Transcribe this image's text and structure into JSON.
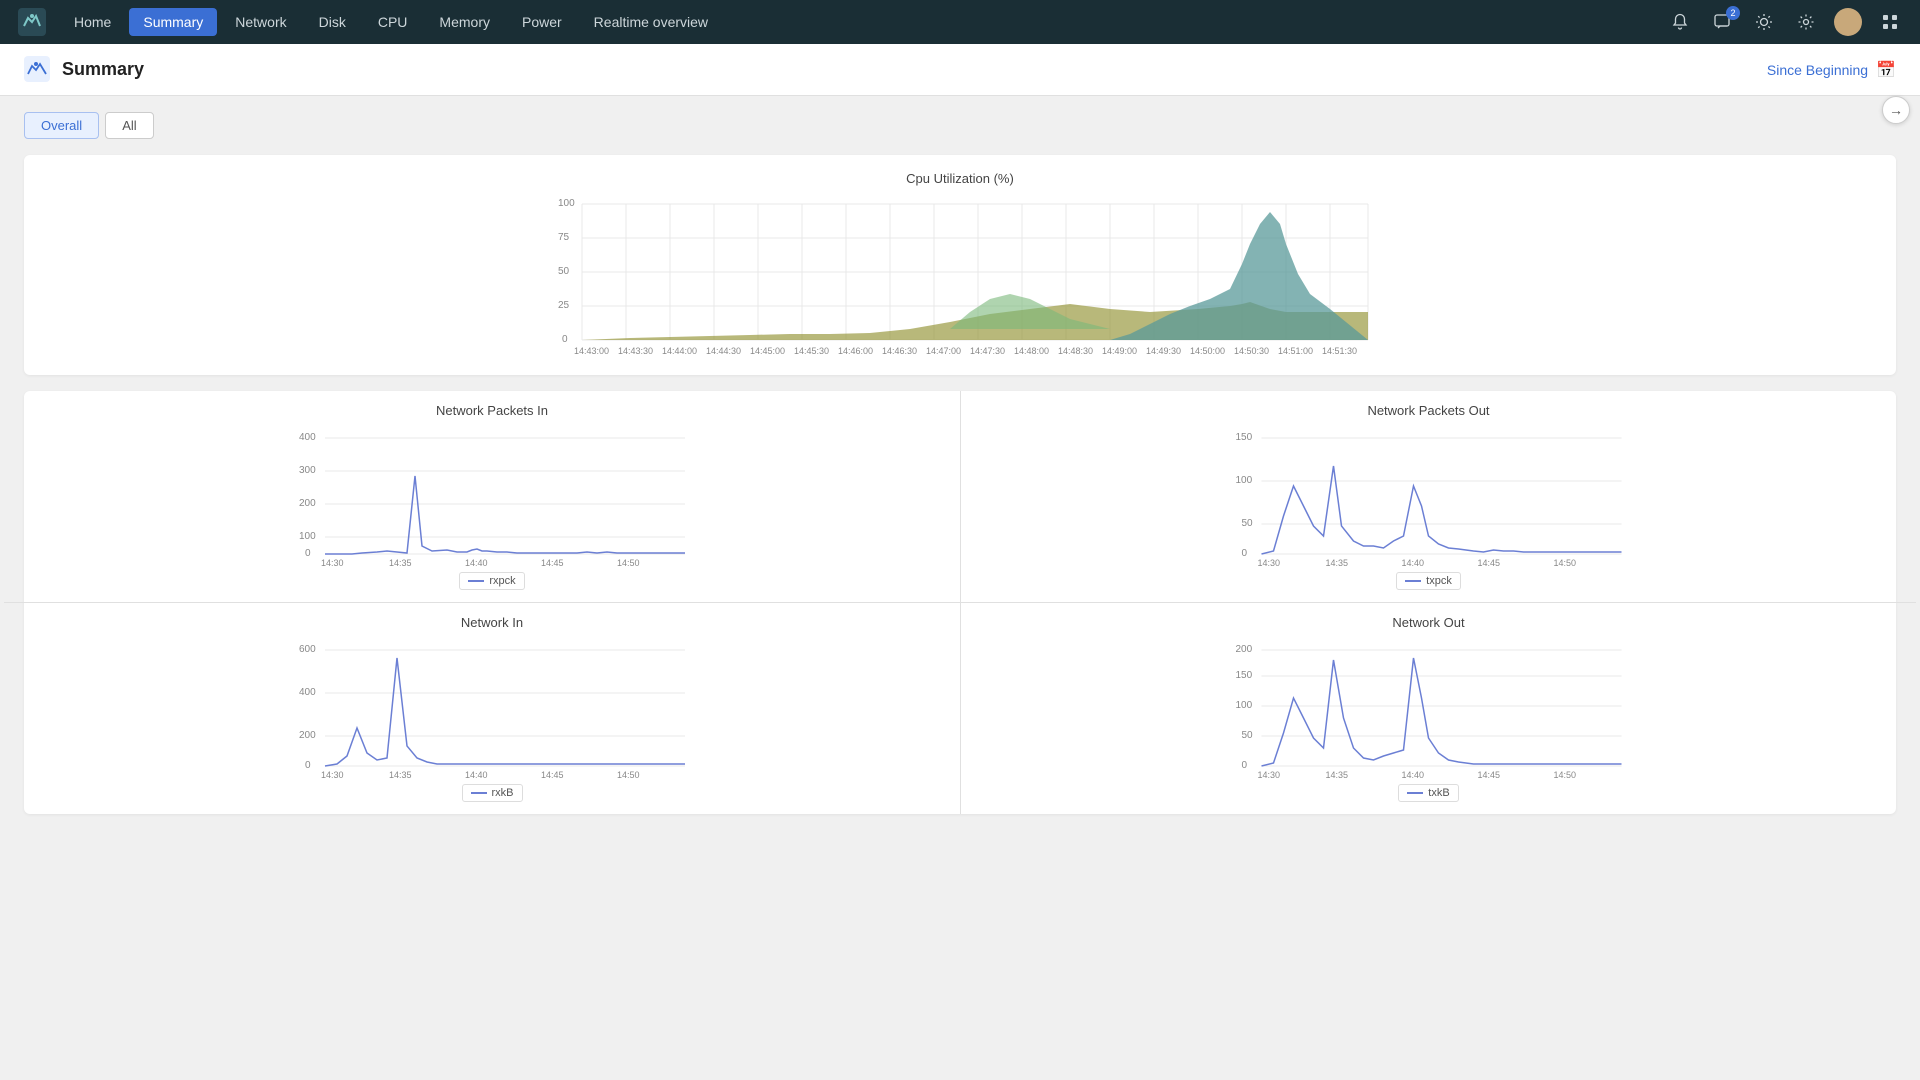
{
  "navbar": {
    "items": [
      {
        "label": "Home",
        "active": false
      },
      {
        "label": "Summary",
        "active": true
      },
      {
        "label": "Network",
        "active": false
      },
      {
        "label": "Disk",
        "active": false
      },
      {
        "label": "CPU",
        "active": false
      },
      {
        "label": "Memory",
        "active": false
      },
      {
        "label": "Power",
        "active": false
      },
      {
        "label": "Realtime overview",
        "active": false
      }
    ],
    "badge_count": "2"
  },
  "subheader": {
    "title": "Summary",
    "since_beginning": "Since Beginning"
  },
  "tabs": [
    {
      "label": "Overall",
      "active": true
    },
    {
      "label": "All",
      "active": false
    }
  ],
  "charts": {
    "cpu_title": "Cpu Utilization (%)",
    "net_packets_in_title": "Network Packets In",
    "net_packets_out_title": "Network Packets Out",
    "net_in_title": "Network In",
    "net_out_title": "Network Out",
    "cpu_yticks": [
      "100",
      "75",
      "50",
      "25",
      "0"
    ],
    "cpu_xticks": [
      "14:43:00",
      "14:43:30",
      "14:44:00",
      "14:44:30",
      "14:45:00",
      "14:45:30",
      "14:46:00",
      "14:46:30",
      "14:47:00",
      "14:47:30",
      "14:48:00",
      "14:48:30",
      "14:49:00",
      "14:49:30",
      "14:50:00",
      "14:50:30",
      "14:51:00",
      "14:51:30"
    ],
    "net_pkt_in_yticks": [
      "400",
      "300",
      "200",
      "100",
      "0"
    ],
    "net_pkt_in_xticks": [
      "14:30",
      "14:35",
      "14:40",
      "14:45",
      "14:50"
    ],
    "net_pkt_out_yticks": [
      "150",
      "100",
      "50",
      "0"
    ],
    "net_pkt_out_xticks": [
      "14:30",
      "14:35",
      "14:40",
      "14:45",
      "14:50"
    ],
    "net_in_yticks": [
      "600",
      "400",
      "200",
      "0"
    ],
    "net_in_xticks": [
      "14:30",
      "14:35",
      "14:40",
      "14:45",
      "14:50"
    ],
    "net_out_yticks": [
      "200",
      "150",
      "100",
      "50",
      "0"
    ],
    "net_out_xticks": [
      "14:30",
      "14:35",
      "14:40",
      "14:45",
      "14:50"
    ],
    "legend_rxpck": "rxpck",
    "legend_txpck": "txpck",
    "legend_rxkB": "rxkB",
    "legend_txkB": "txkB"
  }
}
